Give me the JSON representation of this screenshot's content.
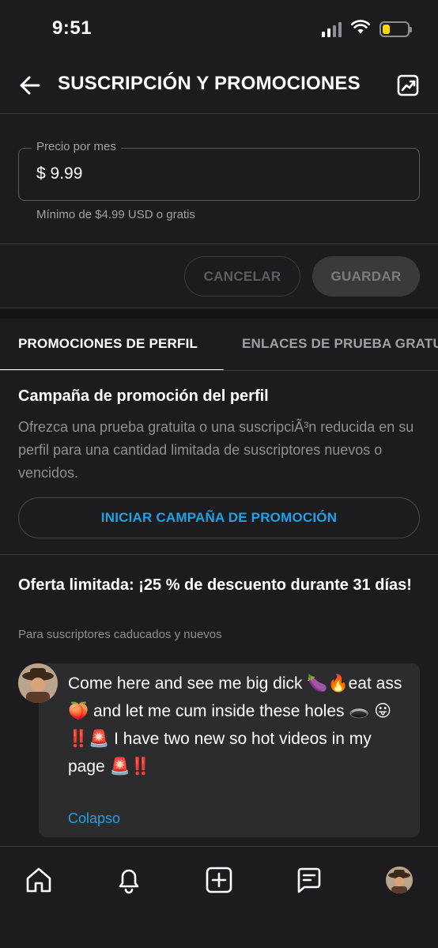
{
  "status": {
    "time": "9:51"
  },
  "header": {
    "title": "SUSCRIPCIÓN Y PROMOCIONES",
    "back_icon": "arrow-left",
    "stats_icon": "trending-chart"
  },
  "price": {
    "label": "Precio por mes",
    "value": "$ 9.99",
    "hint": "Mínimo de $4.99 USD o gratis"
  },
  "actions": {
    "cancel_label": "CANCELAR",
    "save_label": "GUARDAR"
  },
  "tabs": [
    {
      "label": "PROMOCIONES DE PERFIL",
      "active": true
    },
    {
      "label": "ENLACES DE PRUEBA GRATUITA",
      "active": false
    }
  ],
  "campaign": {
    "title": "Campaña de promoción del perfil",
    "description": "Ofrezca una prueba gratuita o una suscripciÃ³n reducida en su perfil para una cantidad limitada de suscriptores nuevos o vencidos.",
    "start_label": "INICIAR CAMPAÑA DE PROMOCIÓN"
  },
  "offer": {
    "title": "Oferta limitada: ¡25 % de descuento durante 31 días!",
    "subtitle": "Para suscriptores caducados y nuevos",
    "message": "Come here and see me big dick 🍆🔥eat ass 🍑 and let me cum inside these holes 🕳️ 😛\n‼️🚨 I have two new so hot videos in my page 🚨‼️",
    "collapse_label": "Colapso"
  },
  "nav": {
    "items": [
      "home",
      "notifications",
      "create",
      "messages",
      "profile"
    ]
  },
  "colors": {
    "background": "#1c1c1e",
    "accent": "#1ea1e6",
    "battery": "#ffd60a"
  }
}
